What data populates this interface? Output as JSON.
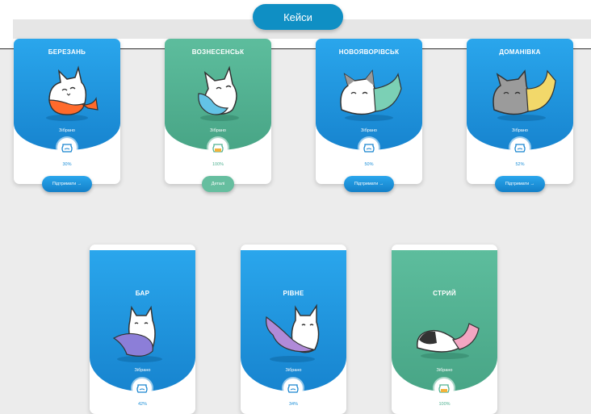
{
  "header": {
    "cases_label": "Кейси"
  },
  "collected_label": "Зібрано",
  "cards": [
    {
      "city": "БЕРЕЗАНЬ",
      "percent": "30%",
      "button": "Підтримати →",
      "theme": "blue",
      "tail_color": "#ff6a2b"
    },
    {
      "city": "ВОЗНЕСЕНСЬК",
      "percent": "100%",
      "button": "Деталі",
      "theme": "green",
      "tail_color": "#63c3e6"
    },
    {
      "city": "НОВОЯВОРІВСЬК",
      "percent": "50%",
      "button": "Підтримати →",
      "theme": "blue",
      "tail_color": "#7bd0b5"
    },
    {
      "city": "ДОМАНІВКА",
      "percent": "52%",
      "button": "Підтримати →",
      "theme": "blue",
      "tail_color": "#f2d86a"
    },
    {
      "city": "БАР",
      "percent": "42%",
      "theme": "blue",
      "tail_color": "#8c7ed8"
    },
    {
      "city": "РІВНЕ",
      "percent": "34%",
      "theme": "blue",
      "tail_color": "#b08ad8"
    },
    {
      "city": "СТРИЙ",
      "percent": "100%",
      "theme": "green",
      "tail_color": "#f3a6c2"
    }
  ],
  "icons": {
    "jar": "fish-jar-icon",
    "arrow": "arrow-right-icon"
  },
  "colors": {
    "accent_blue": "#1784cf",
    "accent_green": "#4fb191",
    "header_pill": "#0f8fc4"
  }
}
